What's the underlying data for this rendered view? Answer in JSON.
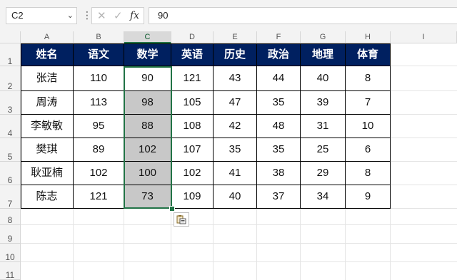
{
  "formula_bar": {
    "name_box": "C2",
    "formula": "90",
    "cancel_glyph": "✕",
    "enter_glyph": "✓",
    "fx_glyph": "fx",
    "more_glyph": "⋮",
    "dropdown_glyph": "⌄"
  },
  "columns": [
    "A",
    "B",
    "C",
    "D",
    "E",
    "F",
    "G",
    "H",
    "I"
  ],
  "rows": [
    "1",
    "2",
    "3",
    "4",
    "5",
    "6",
    "7",
    "8",
    "9",
    "10",
    "11"
  ],
  "table": {
    "headers": [
      "姓名",
      "语文",
      "数学",
      "英语",
      "历史",
      "政治",
      "地理",
      "体育"
    ],
    "data": [
      [
        "张洁",
        "110",
        "90",
        "121",
        "43",
        "44",
        "40",
        "8"
      ],
      [
        "周涛",
        "113",
        "98",
        "105",
        "47",
        "35",
        "39",
        "7"
      ],
      [
        "李敏敏",
        "95",
        "88",
        "108",
        "42",
        "48",
        "31",
        "10"
      ],
      [
        "樊琪",
        "89",
        "102",
        "107",
        "35",
        "35",
        "25",
        "6"
      ],
      [
        "耿亚楠",
        "102",
        "100",
        "102",
        "41",
        "38",
        "29",
        "8"
      ],
      [
        "陈志",
        "121",
        "73",
        "109",
        "40",
        "37",
        "34",
        "9"
      ]
    ]
  },
  "colors": {
    "header_fill": "#002060",
    "selection": "#217346",
    "highlight_fill": "#c8c8c8"
  },
  "icons": {
    "paste_options": "paste-options-icon"
  }
}
